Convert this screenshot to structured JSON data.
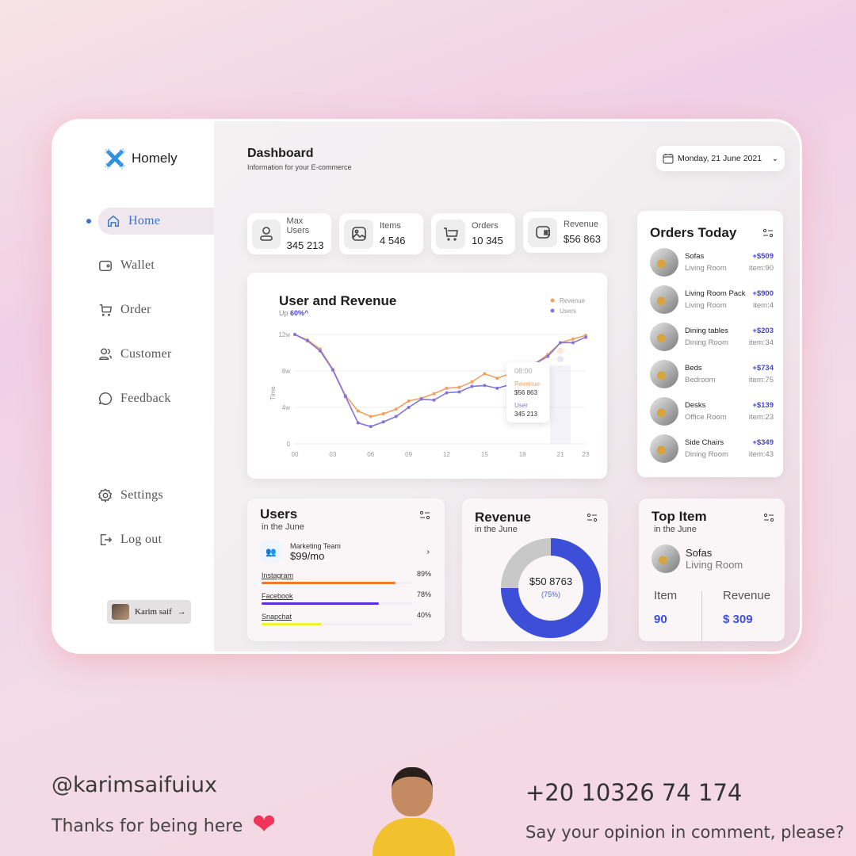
{
  "brand": {
    "name": "Homely"
  },
  "sidebar": {
    "items": [
      {
        "label": "Home",
        "icon": "home-icon",
        "active": true
      },
      {
        "label": "Wallet",
        "icon": "wallet-icon"
      },
      {
        "label": "Order",
        "icon": "cart-icon"
      },
      {
        "label": "Customer",
        "icon": "users-icon"
      },
      {
        "label": "Feedback",
        "icon": "chat-icon"
      }
    ],
    "bottom": [
      {
        "label": "Settings",
        "icon": "gear-icon"
      },
      {
        "label": "Log out",
        "icon": "logout-icon"
      }
    ],
    "user": {
      "name": "Karim saif"
    }
  },
  "header": {
    "title": "Dashboard",
    "subtitle": "Information for your E-commerce",
    "date": "Monday,  21 June 2021"
  },
  "stats": [
    {
      "label": "Max Users",
      "value": "345 213",
      "icon": "user-icon"
    },
    {
      "label": "Items",
      "value": "4 546",
      "icon": "image-icon"
    },
    {
      "label": "Orders",
      "value": "10 345",
      "icon": "cart-icon"
    },
    {
      "label": "Revenue",
      "value": "$56 863",
      "icon": "wallet-icon"
    }
  ],
  "chart_data": {
    "type": "line",
    "title": "User and Revenue",
    "subtitle_prefix": "Up",
    "subtitle_value": "60%^",
    "ylabel": "Time",
    "ylim": [
      0,
      12
    ],
    "yticks": [
      "0",
      "4w",
      "8w",
      "12w"
    ],
    "ytick_values": [
      0,
      4,
      8,
      12
    ],
    "xticks": [
      "00",
      "03",
      "06",
      "09",
      "12",
      "15",
      "18",
      "21",
      "23"
    ],
    "xtick_values": [
      0,
      3,
      6,
      9,
      12,
      15,
      18,
      21,
      23
    ],
    "grid": true,
    "legend": "top-right",
    "x": [
      0,
      1,
      2,
      3,
      4,
      5,
      6,
      7,
      8,
      9,
      10,
      11,
      12,
      13,
      14,
      15,
      16,
      17,
      18,
      19,
      20,
      21,
      22,
      23
    ],
    "series": [
      {
        "name": "Revenue",
        "color": "#f0a160",
        "values": [
          12,
          11.4,
          10.4,
          8.2,
          5.3,
          3.6,
          3.0,
          3.3,
          3.8,
          4.7,
          5.0,
          5.5,
          6.1,
          6.2,
          6.8,
          7.7,
          7.2,
          7.7,
          8.2,
          8.8,
          9.8,
          11.1,
          11.5,
          11.9
        ]
      },
      {
        "name": "Users",
        "color": "#8474d8",
        "values": [
          12,
          11.3,
          10.2,
          8.1,
          5.2,
          2.3,
          1.9,
          2.4,
          3.0,
          4.0,
          4.9,
          4.8,
          5.6,
          5.7,
          6.3,
          6.4,
          6.1,
          6.5,
          7.5,
          8.8,
          9.6,
          11.1,
          11.1,
          11.7
        ]
      }
    ],
    "tooltip": {
      "time": "08:00",
      "revenue_label": "Revenue",
      "revenue_value": "$56 863",
      "user_label": "User",
      "user_value": "345 213"
    }
  },
  "orders_today": {
    "title": "Orders Today",
    "items": [
      {
        "name": "Sofas",
        "category": "Living Room",
        "amount": "+$509",
        "count": "item:90"
      },
      {
        "name": "Living Room Pack",
        "category": "Living Room",
        "amount": "+$900",
        "count": "item:4"
      },
      {
        "name": "Dining tables",
        "category": "Dining Room",
        "amount": "+$203",
        "count": "item:34"
      },
      {
        "name": "Beds",
        "category": "Bedroom",
        "amount": "+$734",
        "count": "item:75"
      },
      {
        "name": "Desks",
        "category": "Office Room",
        "amount": "+$139",
        "count": "item:23"
      },
      {
        "name": "Side Chairs",
        "category": "Dining Room",
        "amount": "+$349",
        "count": "item:43"
      }
    ]
  },
  "users_card": {
    "title": "Users",
    "subtitle": "in the June",
    "team": "Marketing Team",
    "price": "$99/mo",
    "bars": [
      {
        "label": "Instagram",
        "pct": "89%",
        "value": 89,
        "color": "#f07a2a"
      },
      {
        "label": "Facebook",
        "pct": "78%",
        "value": 78,
        "color": "#5a2ee0"
      },
      {
        "label": "Snapchat",
        "pct": "40%",
        "value": 40,
        "color": "#eef52a"
      }
    ]
  },
  "revenue_card": {
    "title": "Revenue",
    "subtitle": "in the June",
    "value": "$50 8763",
    "pct": "(75%)",
    "fraction": 0.75,
    "color": "#3d4fd9"
  },
  "top_item": {
    "title": "Top Item",
    "subtitle": "in the June",
    "name": "Sofas",
    "category": "Living Room",
    "item_label": "Item",
    "item_value": "90",
    "revenue_label": "Revenue",
    "revenue_value": "$ 309"
  },
  "footer": {
    "handle": "@karimsaifuiux",
    "thanks": "Thanks for being here",
    "phone": "+20 10326 74 174",
    "comment": "Say your opinion in comment, please?"
  }
}
